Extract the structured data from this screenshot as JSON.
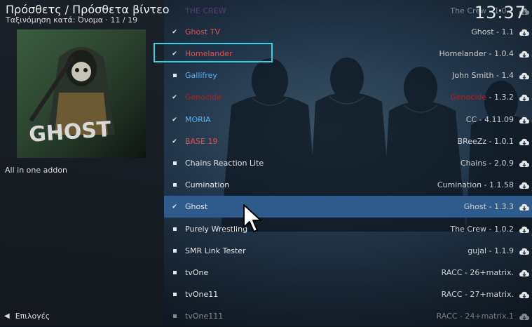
{
  "header": {
    "title": "Πρόσθετς / Πρόσθετα βίντεο",
    "subtitle": "Ταξινόμηση κατά: Όνομα  ·  11 / 19",
    "clock": "13:37"
  },
  "left_panel": {
    "description": "All in one addon",
    "options_label": "Επιλογές"
  },
  "list": [
    {
      "name": "THE CREW",
      "meta": "The Crew - 1.0.2",
      "mark": "none",
      "name_color": "purple",
      "meta_color": "normal",
      "faded": true
    },
    {
      "name": "Ghost TV",
      "meta": "Ghost - 1.1",
      "mark": "check",
      "name_color": "red",
      "meta_color": "normal"
    },
    {
      "name": "Homelander",
      "meta": "Homelander - 1.0.4",
      "mark": "check",
      "name_color": "red",
      "meta_color": "normal"
    },
    {
      "name": "Gallifrey",
      "meta": "John Smith - 1.4",
      "mark": "dot",
      "name_color": "blue",
      "meta_color": "normal"
    },
    {
      "name": "Genocide",
      "meta_prefix": "Genocide",
      "meta": " - 1.3.2",
      "mark": "check",
      "name_color": "dark-red",
      "meta_color": "dark-red-prefix"
    },
    {
      "name": "MORIA",
      "meta": "CC - 4.11.09",
      "mark": "check",
      "name_color": "blue",
      "meta_color": "normal"
    },
    {
      "name": "BASE 19",
      "meta": "BReeZz - 1.0.1",
      "mark": "check",
      "name_color": "red",
      "meta_color": "normal"
    },
    {
      "name": "Chains Reaction Lite",
      "meta": "Chains - 2.0.9",
      "mark": "dot",
      "name_color": "normal",
      "meta_color": "normal"
    },
    {
      "name": "Cumination",
      "meta": "Cumination - 1.1.58",
      "mark": "dot",
      "name_color": "normal",
      "meta_color": "normal"
    },
    {
      "name": "Ghost",
      "meta": "Ghost - 1.3.3",
      "mark": "check",
      "name_color": "normal",
      "meta_color": "normal",
      "selected": true
    },
    {
      "name": "Purely Wrestling",
      "meta": "The Crew - 1.0.2",
      "mark": "dot",
      "name_color": "normal",
      "meta_color": "normal"
    },
    {
      "name": "SMR Link Tester",
      "meta": "gujal - 1.1.9",
      "mark": "dot",
      "name_color": "normal",
      "meta_color": "normal"
    },
    {
      "name": "tvOne",
      "meta": "RACC - 26+matrix.",
      "mark": "dot",
      "name_color": "normal",
      "meta_color": "normal"
    },
    {
      "name": "tvOne11",
      "meta": "RACC - 27+matrix.",
      "mark": "dot",
      "name_color": "normal",
      "meta_color": "normal"
    },
    {
      "name": "tvOne111",
      "meta": "RACC - 24+matrix.1",
      "mark": "dot",
      "name_color": "normal",
      "meta_color": "normal",
      "faded": true
    }
  ],
  "colors": {
    "selected_bg": "#2f5b8c",
    "focus_border": "#37d0e0",
    "red_label": "#e05050",
    "blue_label": "#4fb4ff"
  },
  "icons": {
    "row_action": "cloud-download-icon",
    "installed": "checkmark-icon",
    "not_installed": "dot-icon",
    "options": "chevron-left-icon"
  }
}
